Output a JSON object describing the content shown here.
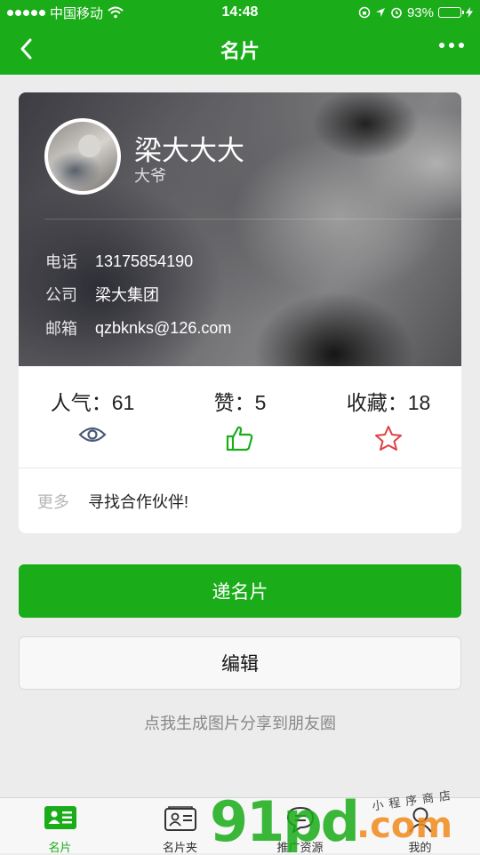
{
  "status_bar": {
    "carrier": "中国移动",
    "time": "14:48",
    "battery": "93%",
    "battery_level": 0.93
  },
  "nav": {
    "title": "名片"
  },
  "profile": {
    "name": "梁大大大",
    "nickname": "大爷",
    "fields": [
      {
        "label": "电话",
        "value": "13175854190"
      },
      {
        "label": "公司",
        "value": "梁大集团"
      },
      {
        "label": "邮箱",
        "value": "qzbknks@126.com"
      }
    ]
  },
  "stats": {
    "views": "人气：61",
    "likes": "赞：5",
    "favorites": "收藏：18"
  },
  "more": {
    "label": "更多",
    "text": "寻找合作伙伴!"
  },
  "actions": {
    "send_card": "递名片",
    "edit": "编辑",
    "share_moments": "点我生成图片分享到朋友圈"
  },
  "tabs": [
    {
      "label": "名片",
      "icon": "card-icon",
      "active": true
    },
    {
      "label": "名片夹",
      "icon": "card-holder-icon",
      "active": false
    },
    {
      "label": "推广资源",
      "icon": "chat-icon",
      "active": false
    },
    {
      "label": "我的",
      "icon": "person-icon",
      "active": false
    }
  ],
  "watermark": {
    "main": "91pd",
    "suffix": ".com",
    "tagline": "小程序商店"
  },
  "colors": {
    "brand_green": "#1aad19",
    "star_red": "#e04040",
    "eye_blue": "#4a5a78"
  }
}
